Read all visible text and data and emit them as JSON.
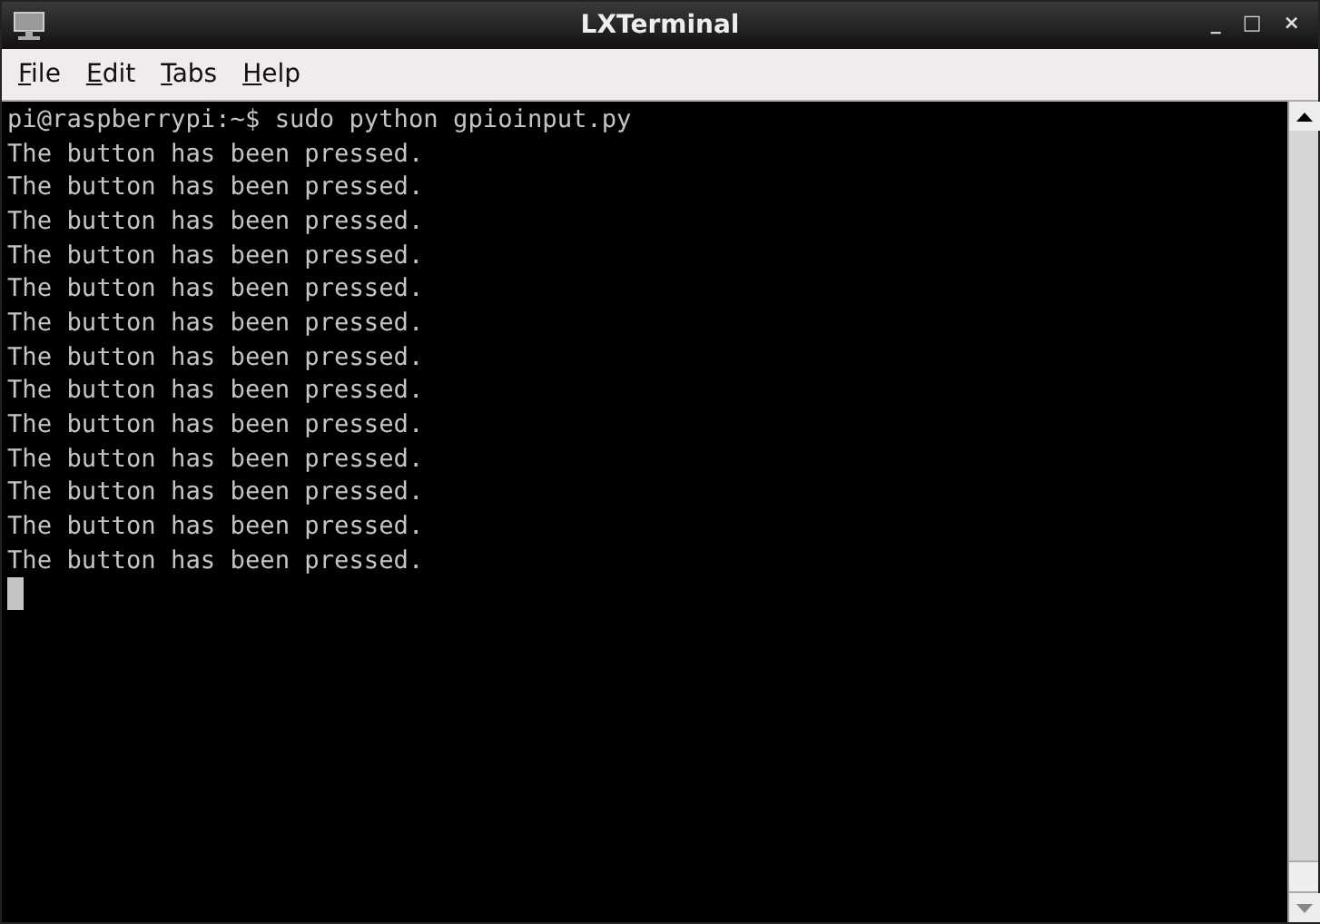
{
  "window": {
    "title": "LXTerminal"
  },
  "menu": [
    "File",
    "Edit",
    "Tabs",
    "Help"
  ],
  "window_controls": [
    "_",
    "□",
    "×"
  ],
  "terminal": {
    "lines": [
      "pi@raspberrypi:~$ sudo python gpioinput.py",
      "The button has been pressed.",
      "The button has been pressed.",
      "The button has been pressed.",
      "The button has been pressed.",
      "The button has been pressed.",
      "The button has been pressed.",
      "The button has been pressed.",
      "The button has been pressed.",
      "The button has been pressed.",
      "The button has been pressed.",
      "The button has been pressed.",
      "The button has been pressed.",
      "The button has been pressed."
    ]
  }
}
